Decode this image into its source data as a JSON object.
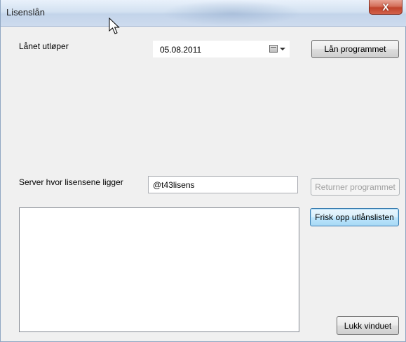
{
  "window": {
    "title": "Lisenslån",
    "close_label": "X"
  },
  "loan": {
    "expires_label": "Lånet utløper",
    "expires_value": "05.08.2011",
    "lend_button": "Lån programmet"
  },
  "server": {
    "label": "Server hvor lisensene ligger",
    "value": "@t43lisens",
    "return_button": "Returner programmet"
  },
  "list": {
    "refresh_button": "Frisk opp utlånslisten",
    "items": []
  },
  "footer": {
    "close_button": "Lukk vinduet"
  },
  "icons": {
    "calendar": "calendar-icon",
    "dropdown": "chevron-down-icon",
    "close": "close-icon",
    "cursor": "mouse-cursor-icon"
  }
}
